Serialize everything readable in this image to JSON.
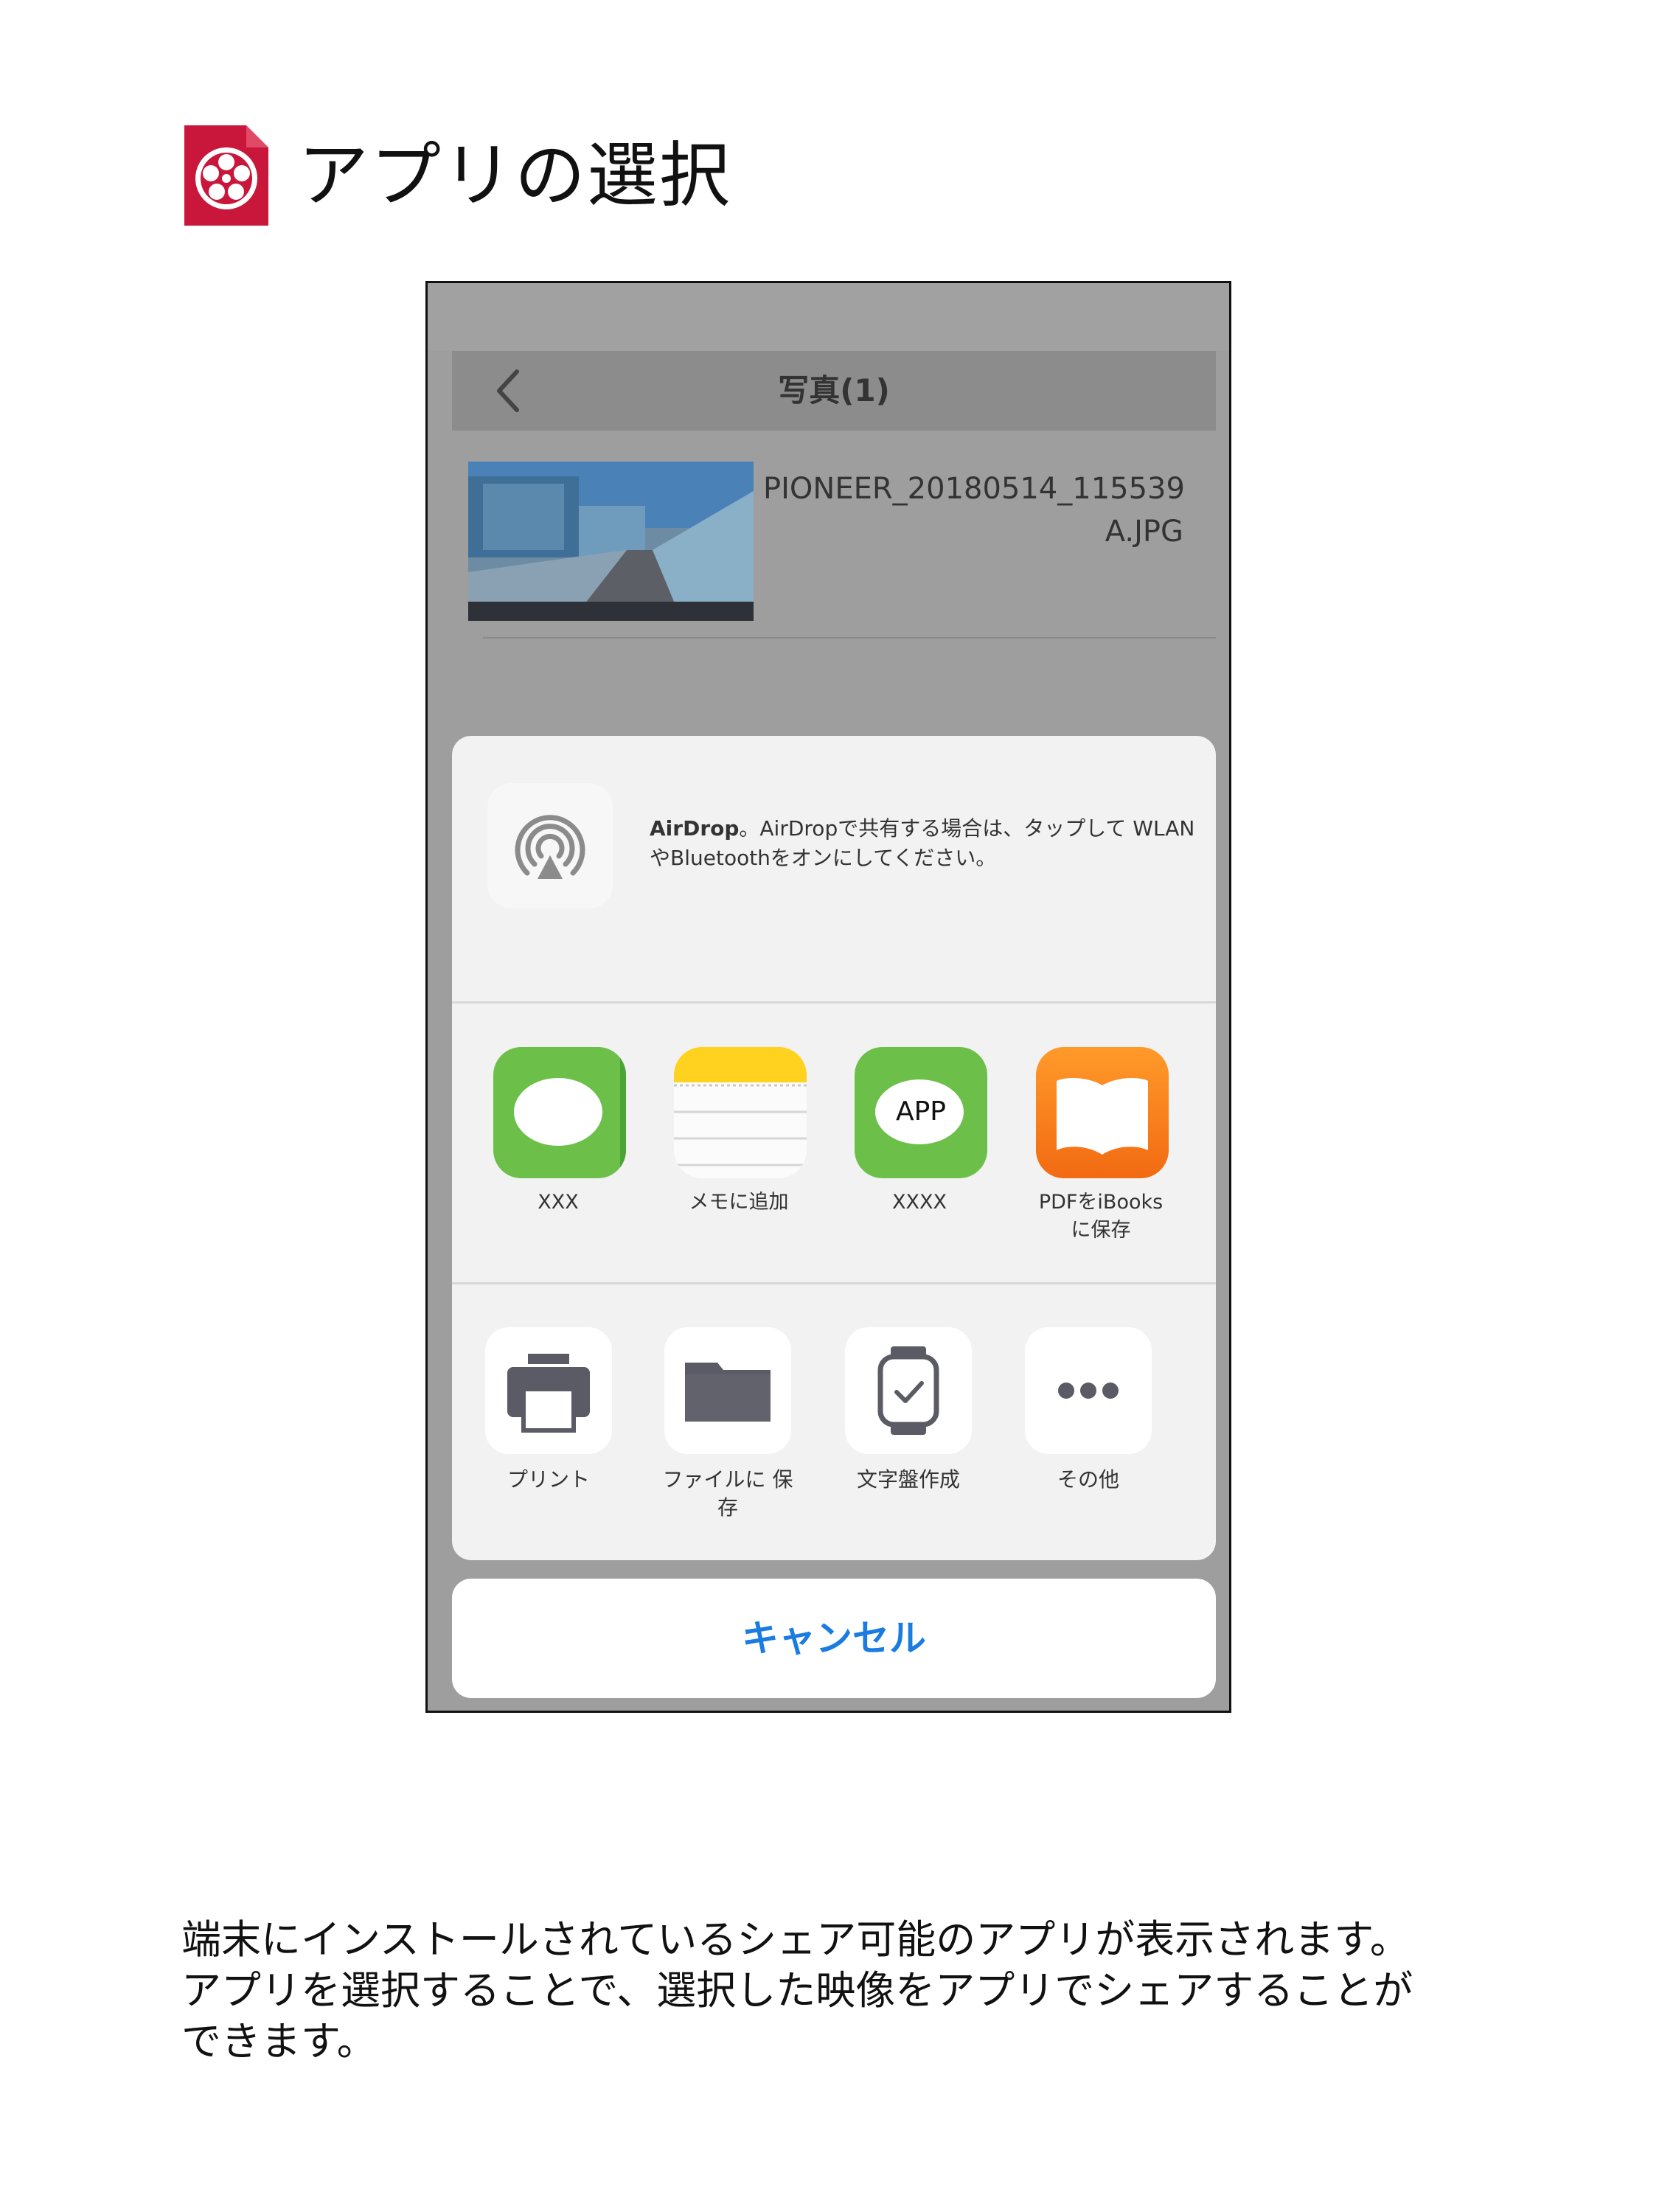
{
  "heading": {
    "title": "アプリの選択"
  },
  "phone": {
    "nav": {
      "title": "写真(1)"
    },
    "file": {
      "name_line1": "PIONEER_20180514_115539",
      "name_line2": "A.JPG"
    },
    "airdrop": {
      "title": "AirDrop",
      "description": "。AirDropで共有する場合は、タップして WLANやBluetoothをオンにしてください。"
    },
    "apps": [
      {
        "label": "XXX",
        "icon": "message-bubble-icon"
      },
      {
        "label": "メモに追加",
        "icon": "notes-icon"
      },
      {
        "label": "XXXX",
        "icon": "app-bubble-icon",
        "badge": "APP"
      },
      {
        "label": "PDFをiBooks に保存",
        "icon": "ibooks-icon"
      }
    ],
    "actions": [
      {
        "label": "プリント",
        "icon": "printer-icon"
      },
      {
        "label": "ファイルに 保存",
        "icon": "folder-icon"
      },
      {
        "label": "文字盤作成",
        "icon": "watch-icon"
      },
      {
        "label": "その他",
        "icon": "more-icon"
      }
    ],
    "cancel_label": "キャンセル"
  },
  "description": {
    "line1": "端末にインストールされているシェア可能のアプリが表示されます。",
    "line2": "アプリを選択することで、選択した映像をアプリでシェアすることが",
    "line3": "できます。"
  },
  "colors": {
    "logo": "#c8173a",
    "accent": "#1a7ce0",
    "messages_green": "#6cc04a",
    "ibooks_orange": "#f58220"
  }
}
